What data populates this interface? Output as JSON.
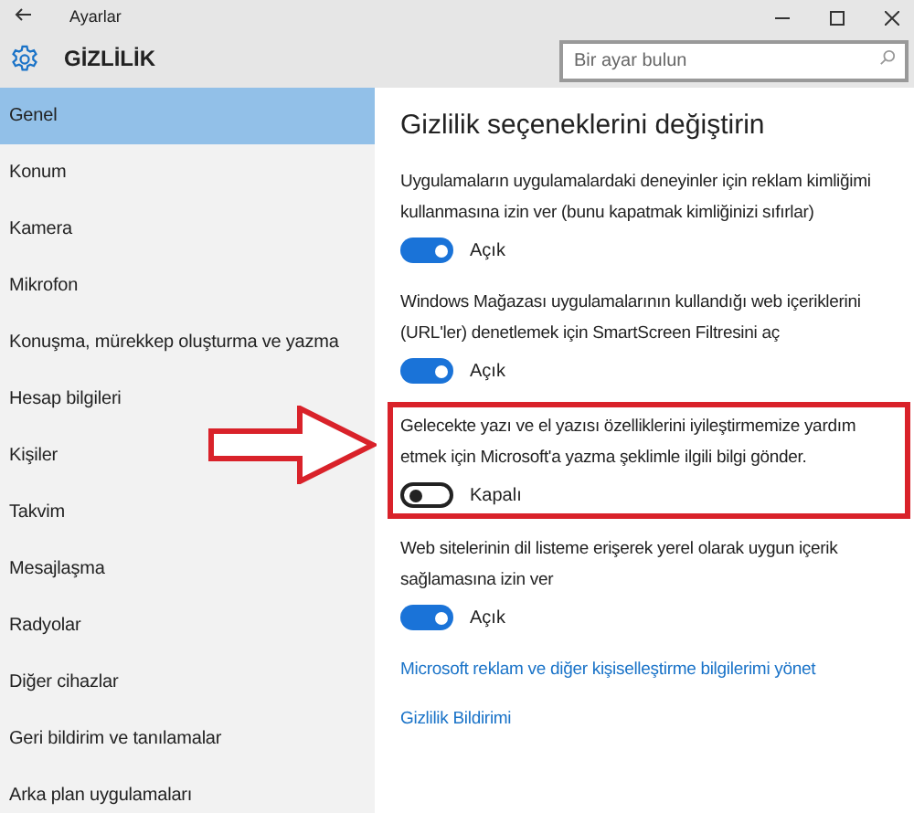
{
  "window": {
    "title": "Ayarlar"
  },
  "header": {
    "title": "GİZLİLİK",
    "search": {
      "placeholder": "Bir ayar bulun"
    }
  },
  "sidebar": {
    "items": [
      {
        "label": "Genel",
        "selected": true
      },
      {
        "label": "Konum",
        "selected": false
      },
      {
        "label": "Kamera",
        "selected": false
      },
      {
        "label": "Mikrofon",
        "selected": false
      },
      {
        "label": "Konuşma, mürekkep oluşturma ve yazma",
        "selected": false
      },
      {
        "label": "Hesap bilgileri",
        "selected": false
      },
      {
        "label": "Kişiler",
        "selected": false
      },
      {
        "label": "Takvim",
        "selected": false
      },
      {
        "label": "Mesajlaşma",
        "selected": false
      },
      {
        "label": "Radyolar",
        "selected": false
      },
      {
        "label": "Diğer cihazlar",
        "selected": false
      },
      {
        "label": "Geri bildirim ve tanılamalar",
        "selected": false
      },
      {
        "label": "Arka plan uygulamaları",
        "selected": false
      }
    ]
  },
  "content": {
    "heading": "Gizlilik seçeneklerini değiştirin",
    "options": [
      {
        "text": "Uygulamaların uygulamalardaki deneyinler için reklam kimliğimi kullanmasına izin ver (bunu kapatmak kimliğinizi sıfırlar)",
        "on": true,
        "state_label": "Açık",
        "highlighted": false
      },
      {
        "text": "Windows Mağazası uygulamalarının kullandığı web içeriklerini (URL'ler) denetlemek için SmartScreen Filtresini aç",
        "on": true,
        "state_label": "Açık",
        "highlighted": false
      },
      {
        "text": "Gelecekte yazı ve el yazısı özelliklerini iyileştirmemize yardım etmek için Microsoft'a yazma şeklimle ilgili bilgi gönder.",
        "on": false,
        "state_label": "Kapalı",
        "highlighted": true
      },
      {
        "text": "Web sitelerinin dil listeme erişerek yerel olarak uygun içerik sağlamasına izin ver",
        "on": true,
        "state_label": "Açık",
        "highlighted": false
      }
    ],
    "links": [
      "Microsoft reklam ve diğer kişiselleştirme bilgilerimi yönet",
      "Gizlilik Bildirimi"
    ]
  }
}
